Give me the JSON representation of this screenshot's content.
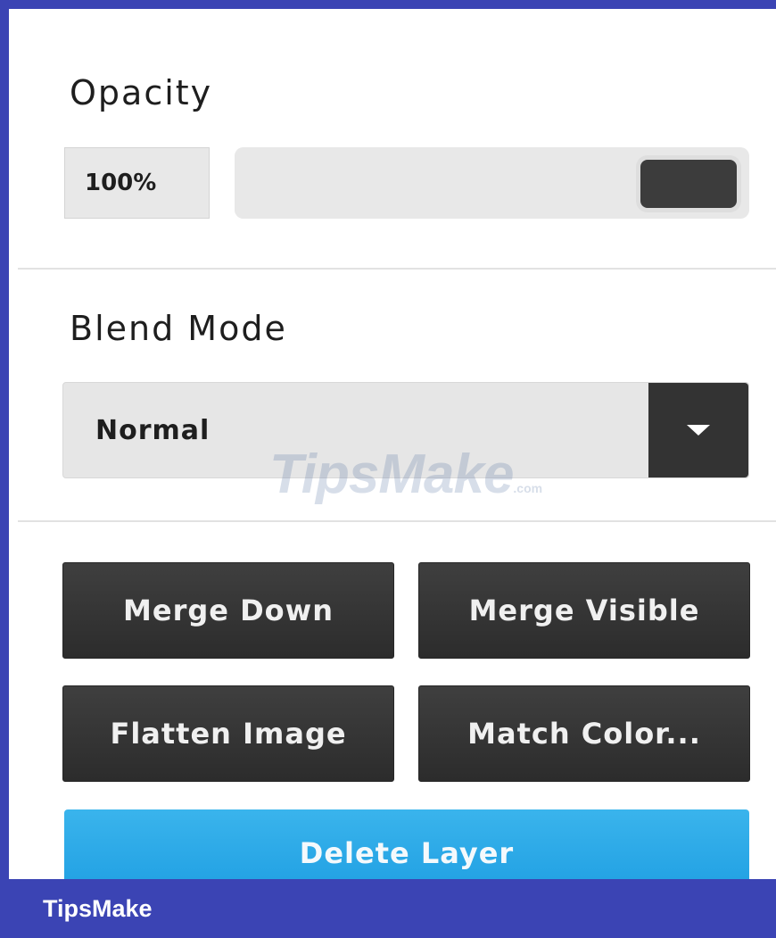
{
  "opacity": {
    "title": "Opacity",
    "value_label": "100%",
    "value_percent": 100
  },
  "blend_mode": {
    "title": "Blend Mode",
    "selected": "Normal",
    "dropdown_icon": "caret-down-icon"
  },
  "actions": {
    "merge_down": "Merge Down",
    "merge_visible": "Merge Visible",
    "flatten_image": "Flatten Image",
    "match_color": "Match Color..."
  },
  "delete": {
    "label": "Delete Layer"
  },
  "watermark": {
    "main": "TipsMake",
    "sub": ".com"
  },
  "brand": {
    "label": "TipsMake"
  },
  "colors": {
    "frame": "#3b44b4",
    "button_dark": "#333333",
    "delete_blue": "#1e9ee2"
  }
}
